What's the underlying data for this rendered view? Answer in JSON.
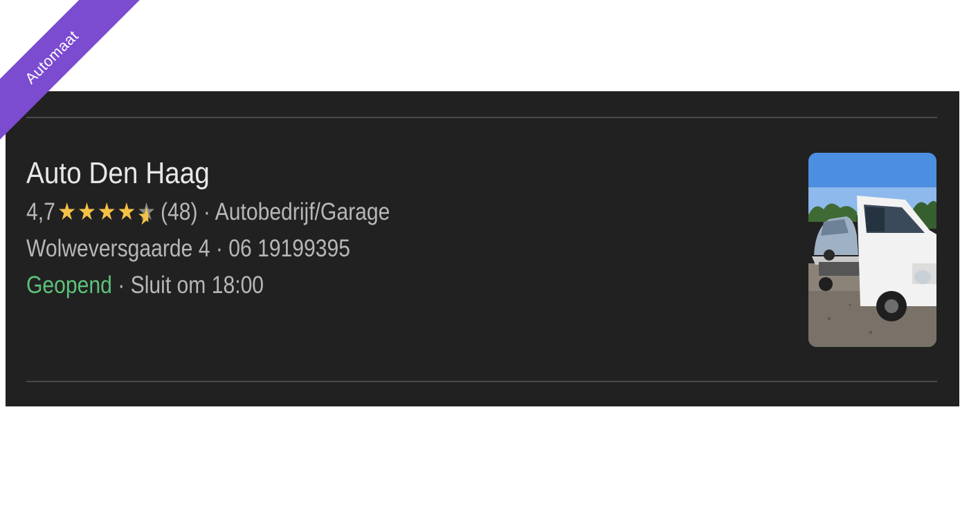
{
  "ribbon": {
    "label": "Automaat",
    "color": "#7b4bd0"
  },
  "listing": {
    "name": "Auto Den Haag",
    "rating": "4,7",
    "rating_value": 4.7,
    "rating_max": 5,
    "reviews": "(48)",
    "separator": "·",
    "category": "Autobedrijf/Garage",
    "address": "Wolweversgaarde 4",
    "phone": "06 19199395",
    "status": "Geopend",
    "hours": "Sluit om 18:00",
    "status_color": "#5dc27a",
    "star_color": "#f4c146"
  },
  "thumbnail": {
    "icon": "tow-truck-photo"
  }
}
